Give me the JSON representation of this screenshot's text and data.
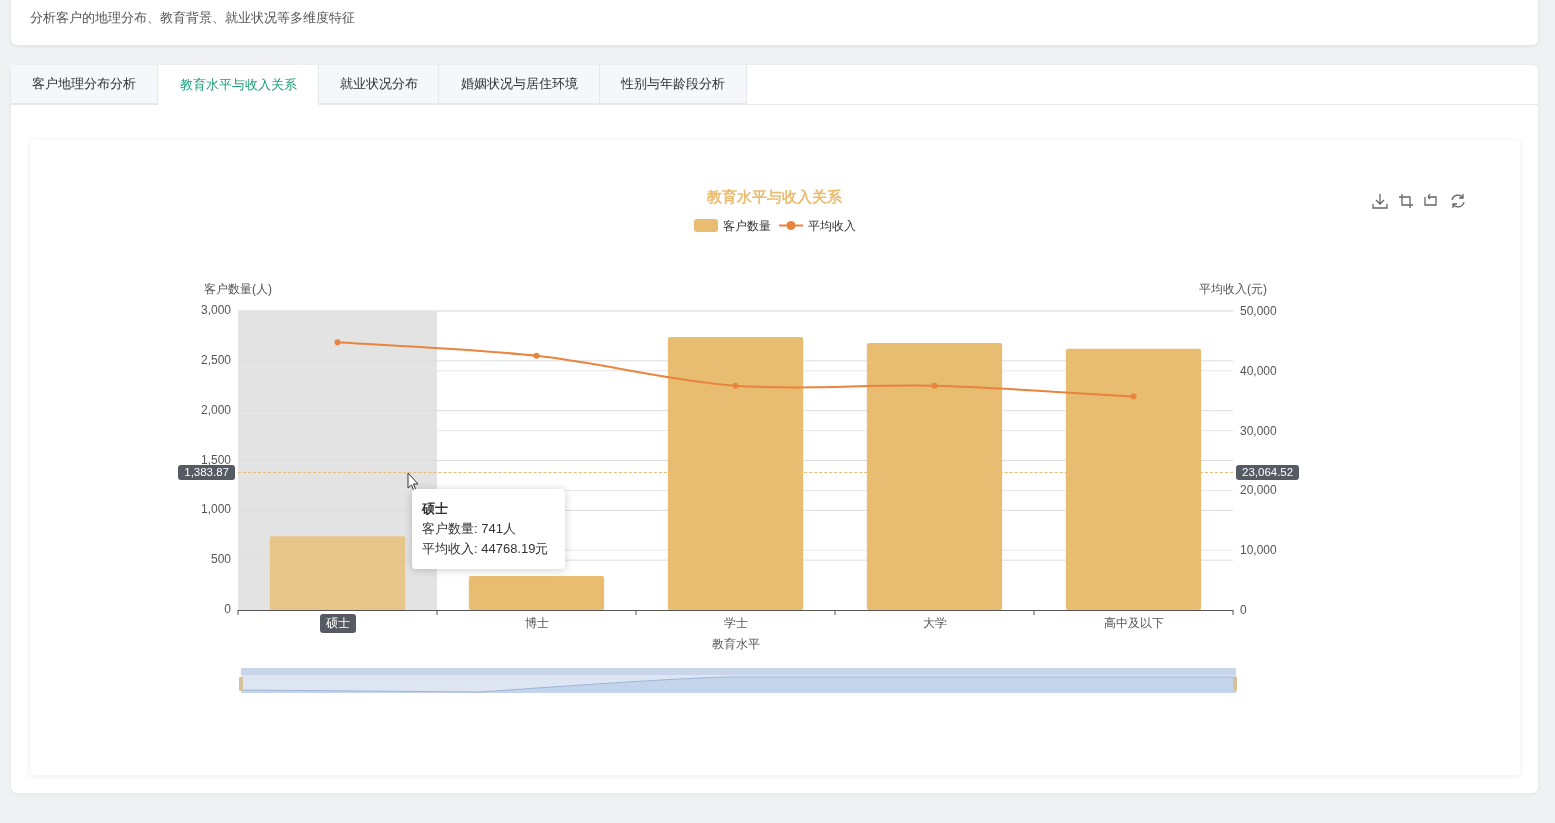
{
  "header": {
    "subtitle": "分析客户的地理分布、教育背景、就业状况等多维度特征"
  },
  "tabs": [
    {
      "label": "客户地理分布分析",
      "selected": false
    },
    {
      "label": "教育水平与收入关系",
      "selected": true
    },
    {
      "label": "就业状况分布",
      "selected": false
    },
    {
      "label": "婚姻状况与居住环境",
      "selected": false
    },
    {
      "label": "性别与年龄段分析",
      "selected": false
    }
  ],
  "chart": {
    "chart_data": {
      "type": "bar",
      "title": "教育水平与收入关系",
      "xlabel": "教育水平",
      "ylabel": "客户数量(人)",
      "categories": [
        "硕士",
        "博士",
        "学士",
        "大学",
        "高中及以下"
      ],
      "series": [
        {
          "name": "客户数量",
          "type": "bar",
          "color": "#e8bd72",
          "values": [
            741,
            340,
            2740,
            2680,
            2620
          ]
        },
        {
          "name": "平均收入",
          "type": "line",
          "axis": "y2",
          "marker": true,
          "color": "#e8843e",
          "values": [
            44768.19,
            42500,
            37500,
            37500,
            35700
          ]
        }
      ],
      "grid": true,
      "legend": "top",
      "ylim": [
        0,
        3000
      ],
      "yticks": [
        {
          "value": 0,
          "label": "0"
        },
        {
          "value": 500,
          "label": "500"
        },
        {
          "value": 1000,
          "label": "1,000"
        },
        {
          "value": 1500,
          "label": "1,500"
        },
        {
          "value": 2000,
          "label": "2,000"
        },
        {
          "value": 2500,
          "label": "2,500"
        },
        {
          "value": 3000,
          "label": "3,000"
        }
      ],
      "y2lim": [
        0,
        50000
      ],
      "y2ticks": [
        {
          "value": 0,
          "label": "0"
        },
        {
          "value": 10000,
          "label": "10,000"
        },
        {
          "value": 20000,
          "label": "20,000"
        },
        {
          "value": 30000,
          "label": "30,000"
        },
        {
          "value": 40000,
          "label": "40,000"
        },
        {
          "value": 50000,
          "label": "50,000"
        }
      ],
      "y2label": "平均收入(元)"
    },
    "axis_pointer": {
      "hovered": [
        true,
        false,
        false,
        false,
        false
      ],
      "left_label": "1,383.87",
      "right_label": "23,064.52"
    },
    "tooltip": {
      "title": "硕士",
      "lines": [
        "客户数量: 741人",
        "平均收入: 44768.19元"
      ]
    }
  }
}
